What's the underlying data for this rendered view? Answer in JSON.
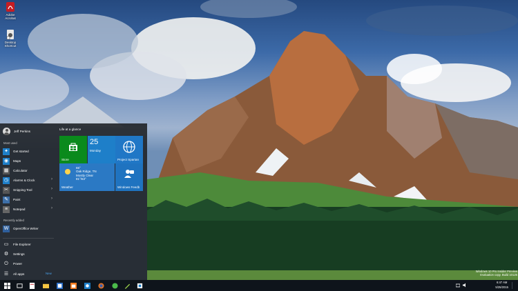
{
  "desktop": {
    "icons": [
      {
        "label": "Adobe Acrobat",
        "icon": "pdf-icon"
      },
      {
        "label": "Desktop Shortcut",
        "icon": "shortcut-icon"
      }
    ]
  },
  "start_menu": {
    "user_name": "Jeff Perkins",
    "most_used_label": "Most used",
    "most_used": [
      {
        "label": "Get started",
        "icon": "lightbulb-icon",
        "color": "#1e7fc9"
      },
      {
        "label": "Maps",
        "icon": "maps-icon",
        "color": "#1e7fc9"
      },
      {
        "label": "Calculator",
        "icon": "calculator-icon",
        "color": "#555555"
      },
      {
        "label": "Alarms & Clock",
        "icon": "clock-icon",
        "color": "#1e7fc9"
      },
      {
        "label": "Snipping Tool",
        "icon": "scissors-icon",
        "color": "#555555"
      },
      {
        "label": "Paint",
        "icon": "paint-icon",
        "color": "#3d6fa8"
      },
      {
        "label": "Notepad",
        "icon": "notepad-icon",
        "color": "#666666"
      }
    ],
    "recently_added_label": "Recently added",
    "recently_added": [
      {
        "label": "OpenOffice Writer",
        "icon": "writer-icon"
      }
    ],
    "bottom": [
      {
        "label": "File Explorer",
        "icon": "folder-icon"
      },
      {
        "label": "Settings",
        "icon": "gear-icon"
      },
      {
        "label": "Power",
        "icon": "power-icon"
      },
      {
        "label": "All apps",
        "icon": "list-icon"
      }
    ],
    "new_label": "New",
    "tiles_header": "Life at a glance",
    "tiles": {
      "store": "Store",
      "calendar_day": "25",
      "calendar_weekday": "Monday",
      "spartan": "Project Spartan",
      "weather_temp": "65°",
      "weather_city": "Oak Ridge, TN",
      "weather_cond": "Mostly Clear",
      "weather_range": "81°/63°",
      "weather": "Weather",
      "feedback": "Windows Feedb"
    }
  },
  "taskbar": {
    "items": [
      "windows-icon",
      "task-view-icon",
      "pdf-icon",
      "file-explorer-icon",
      "office-icon",
      "store-icon",
      "firefox-icon",
      "paint-icon",
      "notepad-icon",
      "snipping-icon"
    ],
    "time": "6:47 AM",
    "date": "5/25/2015"
  },
  "watermark": {
    "line1": "Windows 10 Pro Insider Preview",
    "line2": "Evaluation copy. Build 10125"
  }
}
